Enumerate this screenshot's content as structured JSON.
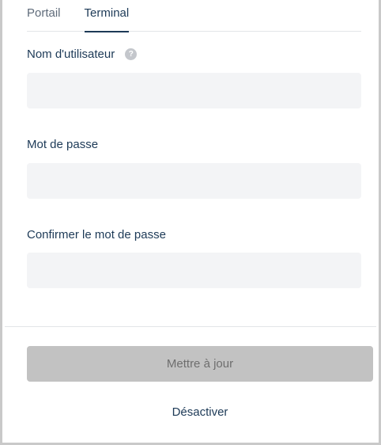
{
  "tabs": [
    {
      "label": "Portail",
      "active": false
    },
    {
      "label": "Terminal",
      "active": true
    }
  ],
  "form": {
    "username": {
      "label": "Nom d'utilisateur",
      "value": "",
      "placeholder": "",
      "help_icon": "question-circle-icon"
    },
    "password": {
      "label": "Mot de passe",
      "value": "",
      "placeholder": ""
    },
    "confirm_password": {
      "label": "Confirmer le mot de passe",
      "value": "",
      "placeholder": ""
    }
  },
  "actions": {
    "update_label": "Mettre à jour",
    "deactivate_label": "Désactiver"
  },
  "colors": {
    "primary_text": "#1d3a57",
    "input_bg": "#f3f4f6",
    "disabled_button_bg": "#c2c2c2"
  }
}
